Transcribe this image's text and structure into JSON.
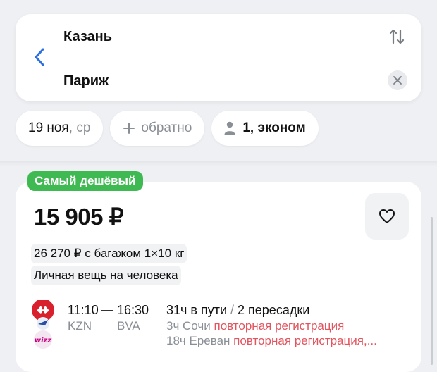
{
  "search": {
    "from": "Казань",
    "to": "Париж"
  },
  "chips": {
    "date_main": "19 ноя",
    "date_sub": ", ср",
    "return_label": "обратно",
    "passengers": "1, эконом"
  },
  "offer": {
    "badge": "Самый дешёвый",
    "price": "15 905 ₽",
    "baggage": "26 270 ₽ с багажом 1×10 кг",
    "personal_item": "Личная вещь на человека",
    "departure_time": "11:10",
    "arrival_time": "16:30",
    "departure_code": "KZN",
    "arrival_code": "BVA",
    "duration": "31ч в пути",
    "transfers": "2 пересадки",
    "stops": [
      {
        "wait": "3ч Сочи",
        "note": "повторная регистрация"
      },
      {
        "wait": "18ч Ереван",
        "note": "повторная регистрация,..."
      }
    ]
  },
  "colors": {
    "accent": "#2b6fe0",
    "badge": "#3fba52",
    "warning": "#e2545e"
  },
  "icons": {
    "back": "chevron-left-icon",
    "swap": "swap-vertical-icon",
    "clear": "close-icon",
    "add": "plus-icon",
    "passenger": "person-icon",
    "favorite": "heart-icon"
  }
}
